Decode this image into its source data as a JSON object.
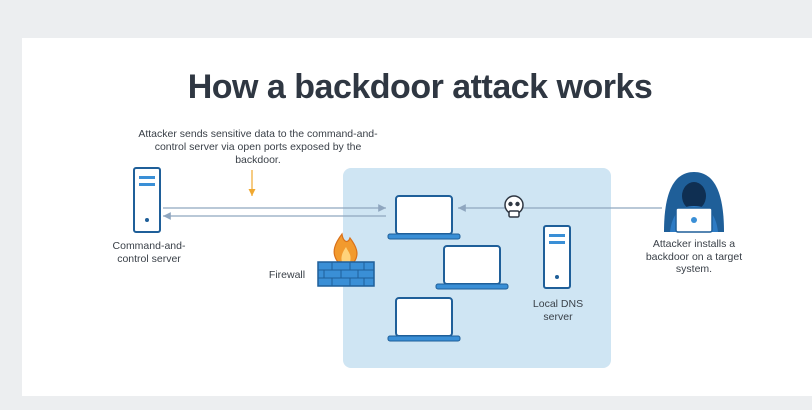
{
  "title": "How a backdoor attack works",
  "annotation": "Attacker sends sensitive data to the command-and-control server via open ports exposed by the backdoor.",
  "labels": {
    "c2_server": "Command-and-control server",
    "firewall": "Firewall",
    "dns_server": "Local DNS server",
    "attacker": "Attacker installs a backdoor on a target system."
  },
  "icons": [
    "server-icon",
    "laptop-icon",
    "firewall-icon",
    "skull-icon",
    "hacker-icon"
  ],
  "colors": {
    "accent": "#3a8fd6",
    "accent_dark": "#1f5f99",
    "zone": "#cfe5f3",
    "arrow": "#8fa6bf",
    "annotation_arrow": "#f0a830",
    "flame": "#f29a2e",
    "title": "#2f3742"
  }
}
